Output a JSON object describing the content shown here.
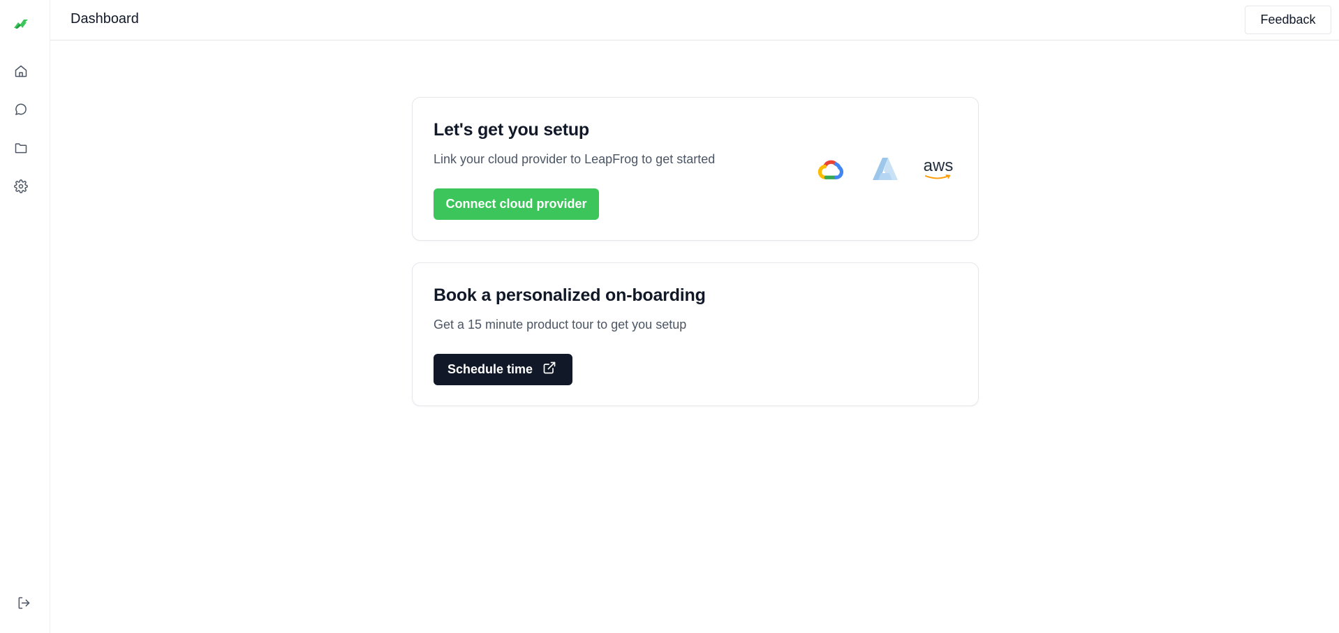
{
  "app": {
    "logo": "leapfrog-logo"
  },
  "sidebar": {
    "items": [
      {
        "name": "home",
        "icon": "home-icon"
      },
      {
        "name": "chat",
        "icon": "chat-icon"
      },
      {
        "name": "folder",
        "icon": "folder-icon"
      },
      {
        "name": "settings",
        "icon": "gear-icon"
      }
    ],
    "logout_icon": "logout-icon"
  },
  "header": {
    "title": "Dashboard",
    "feedback_label": "Feedback"
  },
  "setup_card": {
    "title": "Let's get you setup",
    "description": "Link your cloud provider to LeapFrog to get started",
    "button_label": "Connect cloud provider",
    "providers": [
      {
        "name": "google-cloud",
        "icon": "google-cloud-icon"
      },
      {
        "name": "azure",
        "icon": "azure-icon"
      },
      {
        "name": "aws",
        "label": "aws"
      }
    ]
  },
  "onboarding_card": {
    "title": "Book a personalized on-boarding",
    "description": "Get a 15 minute product tour to get you setup",
    "button_label": "Schedule time",
    "button_icon": "external-link-icon"
  },
  "colors": {
    "accent_green": "#3cc55a",
    "dark_button": "#111827",
    "text_muted": "#4b5563",
    "border": "#e5e7eb"
  }
}
